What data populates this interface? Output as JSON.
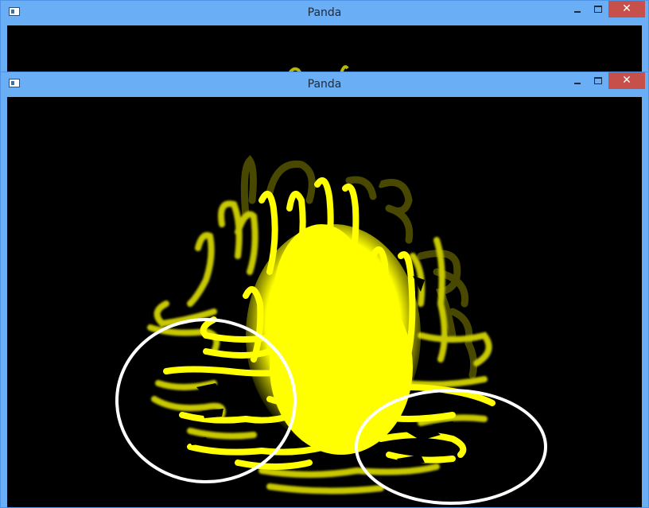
{
  "windows": {
    "back": {
      "title": "Panda",
      "minimize_icon": "minimize-icon",
      "maximize_icon": "maximize-icon",
      "close_glyph": "✕"
    },
    "front": {
      "title": "Panda",
      "minimize_icon": "minimize-icon",
      "maximize_icon": "maximize-icon",
      "close_glyph": "✕"
    }
  },
  "render": {
    "particle_color": "#ffff00",
    "annotation_color": "#ffffff",
    "annotation_count": 2
  }
}
